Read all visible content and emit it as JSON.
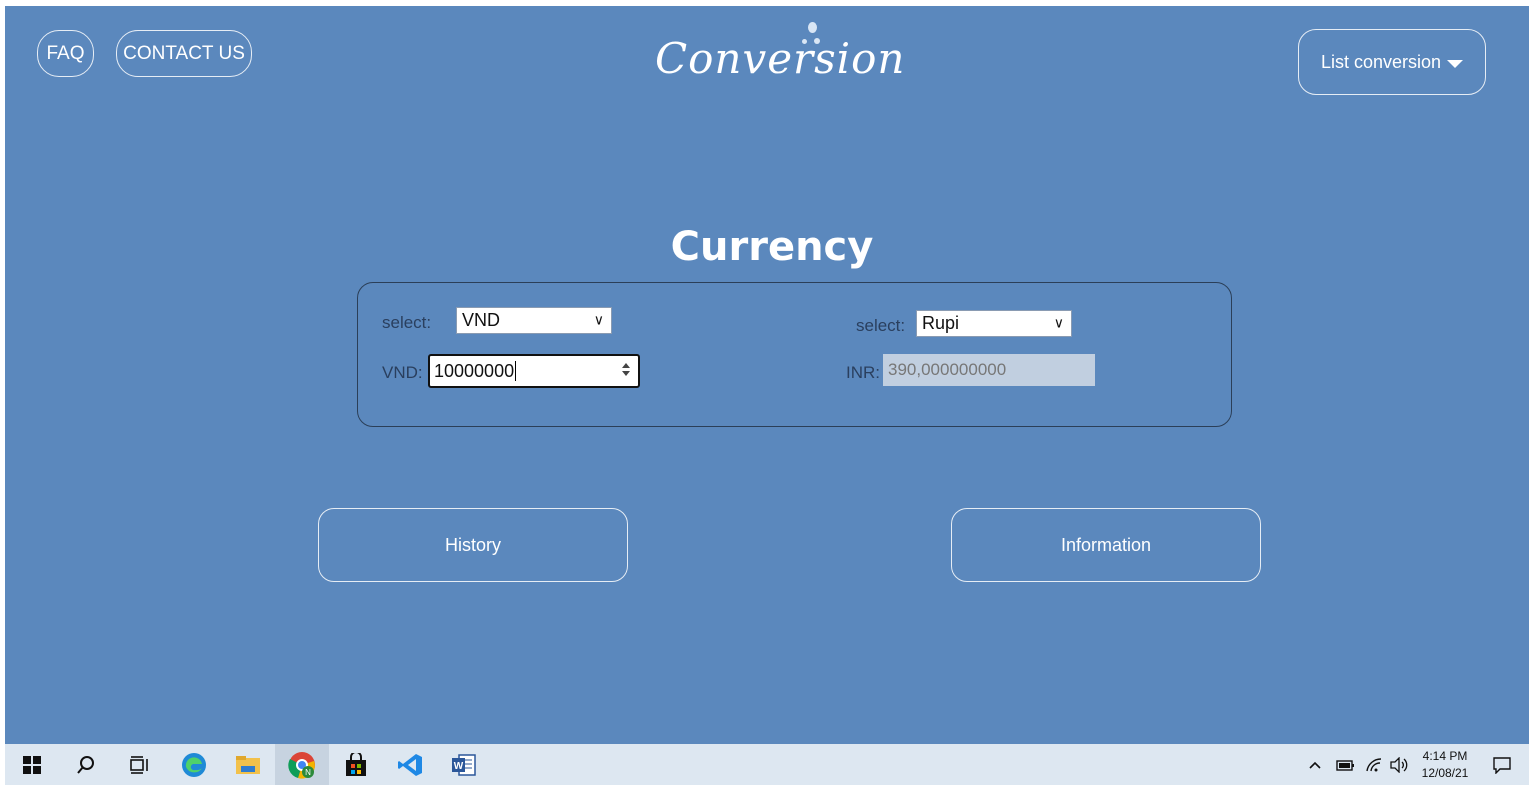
{
  "header": {
    "faq_label": "FAQ",
    "contact_label": "CONTACT US",
    "logo_text": "Conversion",
    "list_conversion_label": "List conversion"
  },
  "main": {
    "title": "Currency",
    "from": {
      "select_label": "select:",
      "selected": "VND",
      "input_label": "VND:",
      "input_value": "10000000"
    },
    "to": {
      "select_label": "select:",
      "selected": "Rupi",
      "output_label": "INR:",
      "output_value": "390,000000000"
    },
    "history_label": "History",
    "information_label": "Information"
  },
  "taskbar": {
    "icons": [
      "windows-start-icon",
      "search-icon",
      "task-view-icon",
      "edge-icon",
      "file-explorer-icon",
      "chrome-icon",
      "store-icon",
      "vscode-icon",
      "word-icon"
    ],
    "time": "4:14 PM",
    "date": "12/08/21"
  },
  "colors": {
    "background": "#5b88bd",
    "panel_border": "#2b3f58",
    "output_bg": "#c1cfe0"
  }
}
